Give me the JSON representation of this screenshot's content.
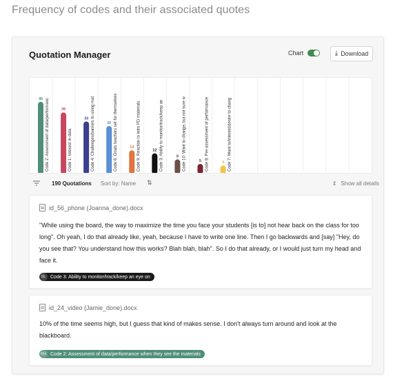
{
  "page": {
    "title": "Frequency of codes and their associated quotes"
  },
  "panel": {
    "title": "Quotation Manager",
    "chart_toggle": {
      "label": "Chart",
      "on": true
    },
    "download_label": "Download"
  },
  "chart_data": {
    "type": "bar",
    "categories": [
      "Code 2: Assessment of data/performanc",
      "Code 1: Interest in data",
      "Code 4: Challenges/barriers to using mat",
      "Code 6: Goals teachers set for themselves",
      "Code 9: Reaction to intro PD materials",
      "Code 3: Ability to monitor/track/keep an",
      "Code 10: Want to change, but not sure w",
      "Code 8: Pre-assessment of performance",
      "Code 7: Want to/interest/desire to chang"
    ],
    "values": [
      46,
      39,
      33,
      30,
      14,
      12,
      8,
      5,
      4
    ],
    "colors": [
      "#4f8f78",
      "#c8465f",
      "#3a3f8f",
      "#5b8fd6",
      "#e0753f",
      "#111111",
      "#6b5046",
      "#7a2438",
      "#f0c54c"
    ],
    "label_colors": [
      "#4f8f78",
      "#c8465f",
      "#3a3f8f",
      "#5b8fd6",
      "#e0753f",
      "#111111",
      "#6b5046",
      "#7a2438",
      "#d8b54a"
    ],
    "empty_slots": 6,
    "grid": true,
    "ylim": [
      0,
      50
    ]
  },
  "toolbar": {
    "count": "190 Quotations",
    "sort": "Sort by: Name",
    "show_all": "Show all details"
  },
  "quotes": [
    {
      "doc": "id_56_phone (Joanna_done).docx",
      "text": "\"While using the board, the way to maximize the time you face your students [is to] not hear back on the class for too long\". Oh yeah, I do that already like, yeah, because I have to write one line. Then I go backwards and [say] \"Hey, do you see that? You understand how this works? Blah blah, blah\". So I do that already, or I would just turn my head and face it.",
      "code_initials": "SL",
      "code": "Code 3: Ability to monitor/track/keep an eye on",
      "code_color": "#1b1b1b"
    },
    {
      "doc": "id_24_video (Jamie_done).docx",
      "text": "10% of the time seems high, but I guess that kind of makes sense. I don't always turn around and look at the blackboard.",
      "code_initials": "KH",
      "code": "Code 2: Assessment of data/performance when they see the materials",
      "code_color": "#4f8f78"
    }
  ]
}
